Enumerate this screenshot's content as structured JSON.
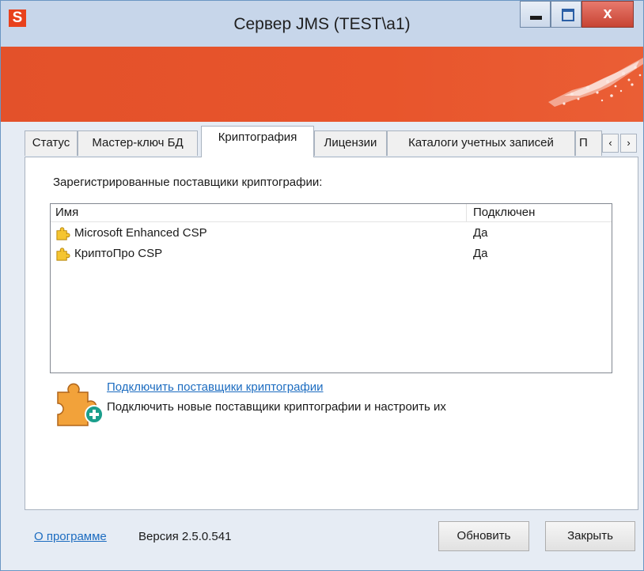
{
  "window": {
    "title": "Сервер JMS (TEST\\a1)",
    "app_icon_letter": "S",
    "close_glyph": "x"
  },
  "tabs": [
    {
      "label": "Статус",
      "active": false
    },
    {
      "label": "Мастер-ключ БД",
      "active": false
    },
    {
      "label": "Криптография",
      "active": true
    },
    {
      "label": "Лицензии",
      "active": false
    },
    {
      "label": "Каталоги учетных записей",
      "active": false
    },
    {
      "label": "П",
      "active": false
    }
  ],
  "tab_scroll": {
    "left": "‹",
    "right": "›"
  },
  "panel": {
    "caption": "Зарегистрированные поставщики криптографии:",
    "list": {
      "columns": [
        "Имя",
        "Подключен"
      ],
      "rows": [
        {
          "name": "Microsoft Enhanced CSP",
          "connected": "Да",
          "icon": "puzzle-icon"
        },
        {
          "name": "КриптоПро CSP",
          "connected": "Да",
          "icon": "puzzle-icon"
        }
      ]
    },
    "action": {
      "link": "Подключить поставщики криптографии",
      "description": "Подключить новые поставщики криптографии и настроить их",
      "icon": "puzzle-add-icon"
    }
  },
  "footer": {
    "about_link": "О программе",
    "version": "Версия 2.5.0.541",
    "refresh_button": "Обновить",
    "close_button": "Закрыть"
  },
  "colors": {
    "banner": "#e8552c",
    "link": "#1c6cc0",
    "titlebar": "#c7d6ea"
  }
}
